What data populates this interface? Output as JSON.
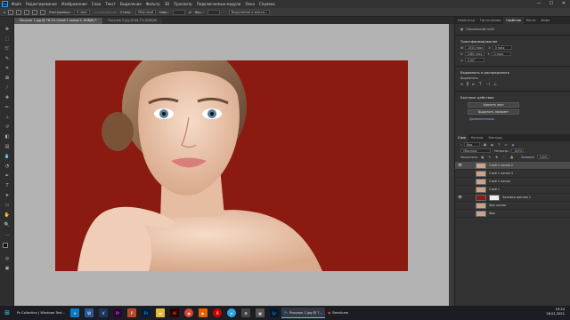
{
  "menubar": {
    "logo": "Ps",
    "items": [
      "Файл",
      "Редактирование",
      "Изображение",
      "Слои",
      "Текст",
      "Выделение",
      "Фильтр",
      "3D",
      "Просмотр",
      "Подключаемые модули",
      "Окно",
      "Справка"
    ],
    "win_controls": [
      "—",
      "☐",
      "✕"
    ]
  },
  "options": {
    "mode_label": "Растушевка:",
    "feather_value": "0 пикс",
    "smooth_label": "Сглаживание",
    "style_label": "Стиль:",
    "style_value": "Обычный",
    "width_label": "Шир.:",
    "height_label": "Выс.:",
    "select_mask_button": "Выделение и маска..."
  },
  "tabs": [
    {
      "label": "Рисунок 1.jpg @ 78,1% (Слой 1 копия 2, RGB/8) *",
      "active": true
    },
    {
      "label": "Рисунок 2.jpg @ 66,7% (RGB/8)",
      "active": false
    }
  ],
  "panel_tabs_top": [
    "Навигатор",
    "Гистограмма",
    "Свойства",
    "Кисти",
    "Инфо"
  ],
  "properties": {
    "layer_type": "Пиксельный слой",
    "transform_section": "Трансформирование",
    "w_value": "1920 пикс",
    "h_value": "1080 пикс",
    "x_value": "0 пикс",
    "y_value": "0 пикс",
    "angle_value": "0,00°",
    "align_section": "Выровнять и распределить",
    "align_label": "Выровнять:",
    "quick_actions_section": "Быстрые действия",
    "remove_bg_button": "Удалить фон",
    "select_subject_button": "Выделить предмет",
    "more_link": "Дополнительно"
  },
  "panel_tabs_layers": [
    "Слои",
    "Каналы",
    "Контуры"
  ],
  "layers_panel": {
    "kind_label": "Вид",
    "blend_mode": "Обычные",
    "opacity_label": "Непрозр.:",
    "opacity_value": "100%",
    "lock_label": "Закрепить:",
    "fill_label": "Заливка:",
    "fill_value": "100%",
    "layers": [
      {
        "name": "Слой 1 копия 2",
        "visible": true,
        "selected": true,
        "thumb": "photo"
      },
      {
        "name": "Слой 1 копия 3",
        "visible": false,
        "selected": false,
        "thumb": "photo"
      },
      {
        "name": "Слой 1 копия",
        "visible": false,
        "selected": false,
        "thumb": "photo"
      },
      {
        "name": "Слой 1",
        "visible": false,
        "selected": false,
        "thumb": "photo"
      },
      {
        "name": "Заливка цветом 1",
        "visible": true,
        "selected": false,
        "thumb": "red"
      },
      {
        "name": "Фон копия",
        "visible": false,
        "selected": false,
        "thumb": "photo"
      },
      {
        "name": "Фон",
        "visible": false,
        "selected": false,
        "thumb": "photo"
      }
    ]
  },
  "taskbar": {
    "first_app": "Ps Collection | Windows Test...",
    "active_app": "Рисунок 1.jpg @ 7...",
    "bandicam": "Bandicam",
    "time": "19:24",
    "date": "26.01.2021"
  },
  "colors": {
    "canvas_bg": "#8b1a10",
    "workspace": "#b3b3b3",
    "panel": "#323232",
    "accent": "#31a8ff"
  }
}
